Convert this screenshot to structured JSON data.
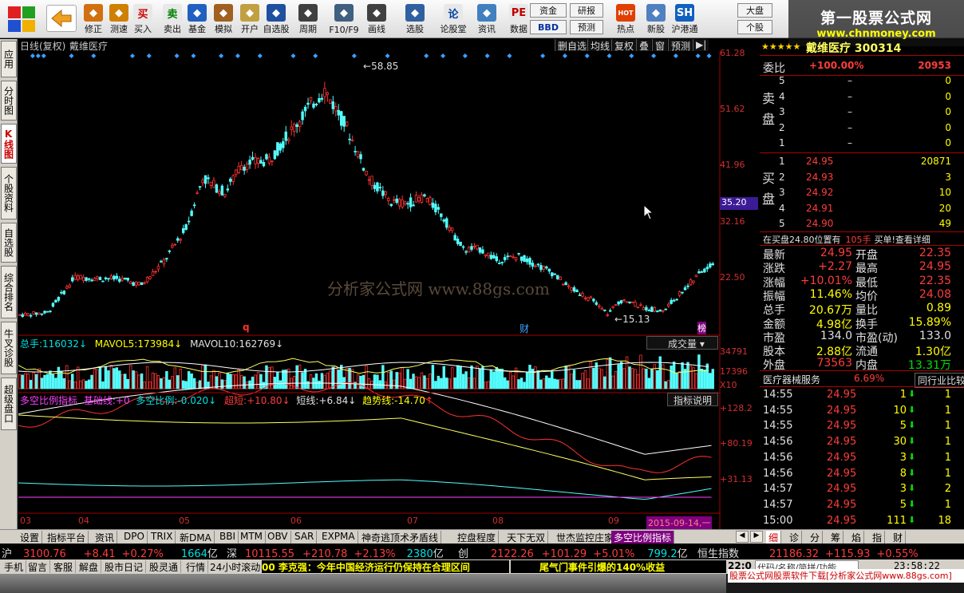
{
  "toolbar": {
    "buttons": [
      {
        "label": "修正",
        "icon": "up-down-icon",
        "color": "#d07010"
      },
      {
        "label": "测速",
        "icon": "clock-icon",
        "color": "#d08000"
      },
      {
        "label": "买入",
        "icon": "buy-icon",
        "glyph": "买",
        "color": "#e8e8e8",
        "glyph_color": "#d00000"
      },
      {
        "label": "卖出",
        "icon": "sell-icon",
        "glyph": "卖",
        "color": "#e8e8e8",
        "glyph_color": "#008000"
      },
      {
        "label": "基金",
        "icon": "fund-icon",
        "color": "#2060c0"
      },
      {
        "label": "模拟",
        "icon": "hammer-icon",
        "color": "#a06020"
      },
      {
        "label": "开户",
        "icon": "lock-icon",
        "color": "#c0a040"
      },
      {
        "label": "自选股",
        "icon": "star-icon",
        "color": "#2050a0"
      },
      {
        "label": "周期",
        "icon": "clock-icon",
        "color": "#404040"
      },
      {
        "label": "F10/F9",
        "icon": "document-icon",
        "color": "#406080"
      },
      {
        "label": "画线",
        "icon": "pen-icon",
        "color": "#404040"
      },
      {
        "label": "选股",
        "icon": "grid-icon",
        "color": "#3060a0"
      },
      {
        "label": "论股堂",
        "icon": "forum-icon",
        "glyph": "论",
        "color": "#e8e8e8",
        "glyph_color": "#0040a0"
      },
      {
        "label": "资讯",
        "icon": "news-icon",
        "color": "#4080c0"
      },
      {
        "label": "数据",
        "icon": "pe-icon",
        "glyph": "PE",
        "color": "#e8e8e8",
        "glyph_color": "#c00000"
      },
      {
        "label": "热点",
        "icon": "hot-icon",
        "glyph": "HOT",
        "color": "#e04000"
      },
      {
        "label": "新股",
        "icon": "new-stock-icon",
        "color": "#5080c0"
      },
      {
        "label": "沪港通",
        "icon": "hk-link-icon",
        "glyph": "SH",
        "color": "#1060c0"
      }
    ],
    "chips": {
      "fund": "资金",
      "bbd": "BBD",
      "research": "研报",
      "forecast": "预测",
      "market": "大盘",
      "single": "个股"
    }
  },
  "logo_banner": {
    "line1": "第一股票公式网",
    "line2": "www.chnmoney.com"
  },
  "left_tabs": [
    "应用",
    "分时图",
    "K线图",
    "个股资料",
    "自选股",
    "综合排名",
    "牛叉诊股",
    "超级盘口"
  ],
  "chart": {
    "header": {
      "period": "日线(复权)",
      "name": "戴维医疗"
    },
    "header_buttons": [
      "删自选",
      "均线",
      "复权",
      "叠",
      "窗",
      "预测",
      "▶|"
    ],
    "y_axis": [
      "61.28",
      "51.62",
      "41.96",
      "35.20",
      "32.16",
      "22.50"
    ],
    "cursor_price": "35.20",
    "high_label": "58.85",
    "low_label": "15.13",
    "markers": {
      "q": "q",
      "cai": "财",
      "bang": "榜"
    },
    "watermark": "分析家公式网  www.88gs.com"
  },
  "volume": {
    "total_label": "总手:",
    "total": "116032",
    "mavol5_label": "MAVOL5:",
    "mavol5": "173984",
    "mavol10_label": "MAVOL10:",
    "mavol10": "162769",
    "selector": "成交量",
    "axis": [
      "34791",
      "17396",
      "X10"
    ]
  },
  "indicator": {
    "name": "多空比例指标",
    "base_label": "基础线:",
    "base": "+0",
    "ratio_label": "多空比例:",
    "ratio": "-0.020",
    "ultrashort_label": "超短:",
    "ultrashort": "+10.80",
    "short_label": "短线:",
    "short": "+6.84",
    "trend_label": "趋势线:",
    "trend": "-14.70",
    "help": "指标说明",
    "axis": [
      "+128.2",
      "+80.19",
      "+31.13"
    ]
  },
  "x_axis": [
    "03",
    "04",
    "05",
    "06",
    "07",
    "08",
    "09",
    "2015-09-14,一"
  ],
  "right_panel": {
    "title": "戴维医疗 300314",
    "weibi_label": "委比",
    "weibi": "+100.00%",
    "weibi_val": "20953",
    "sell_label": "卖盘",
    "buy_label": "买盘",
    "sell": [
      {
        "n": "5",
        "p": "–",
        "v": "0"
      },
      {
        "n": "4",
        "p": "–",
        "v": "0"
      },
      {
        "n": "3",
        "p": "–",
        "v": "0"
      },
      {
        "n": "2",
        "p": "–",
        "v": "0"
      },
      {
        "n": "1",
        "p": "–",
        "v": "0"
      }
    ],
    "buy": [
      {
        "n": "1",
        "p": "24.95",
        "v": "20871"
      },
      {
        "n": "2",
        "p": "24.93",
        "v": "3"
      },
      {
        "n": "3",
        "p": "24.92",
        "v": "10"
      },
      {
        "n": "4",
        "p": "24.91",
        "v": "20"
      },
      {
        "n": "5",
        "p": "24.90",
        "v": "49"
      }
    ],
    "buy_notice": {
      "prefix": "在买盘24.80位置有",
      "amount": "105手",
      "suffix": "买单!",
      "link": "查看详细"
    },
    "stats": [
      {
        "l1": "最新",
        "v1": "24.95",
        "c1": "red",
        "l2": "开盘",
        "v2": "22.35",
        "c2": "red"
      },
      {
        "l1": "涨跌",
        "v1": "+2.27",
        "c1": "red",
        "l2": "最高",
        "v2": "24.95",
        "c2": "red"
      },
      {
        "l1": "涨幅",
        "v1": "+10.01%",
        "c1": "red",
        "l2": "最低",
        "v2": "22.35",
        "c2": "red"
      },
      {
        "l1": "振幅",
        "v1": "11.46%",
        "c1": "yel",
        "l2": "均价",
        "v2": "24.08",
        "c2": "red"
      },
      {
        "l1": "总手",
        "v1": "20.67万",
        "c1": "yel",
        "l2": "量比",
        "v2": "0.89",
        "c2": "yel"
      },
      {
        "l1": "金额",
        "v1": "4.98亿",
        "c1": "yel",
        "l2": "换手",
        "v2": "15.89%",
        "c2": "yel"
      },
      {
        "l1": "市盈",
        "v1": "134.0",
        "c1": "wh",
        "l2": "市盈(动)",
        "v2": "133.0",
        "c2": "wh"
      },
      {
        "l1": "股本",
        "v1": "2.88亿",
        "c1": "yel",
        "l2": "流通",
        "v2": "1.30亿",
        "c2": "yel"
      },
      {
        "l1": "外盘",
        "v1": "73563",
        "c1": "red",
        "l2": "内盘",
        "v2": "13.31万",
        "c2": "grn"
      }
    ],
    "industry": {
      "name": "医疗器械服务",
      "pct": "6.69%",
      "btn": "同行业比较"
    },
    "ticks": [
      {
        "t": "14:55",
        "p": "24.95",
        "v": "1",
        "d": "1"
      },
      {
        "t": "14:55",
        "p": "24.95",
        "v": "10",
        "d": "1"
      },
      {
        "t": "14:55",
        "p": "24.95",
        "v": "5",
        "d": "1"
      },
      {
        "t": "14:56",
        "p": "24.95",
        "v": "30",
        "d": "1"
      },
      {
        "t": "14:56",
        "p": "24.95",
        "v": "3",
        "d": "1"
      },
      {
        "t": "14:56",
        "p": "24.95",
        "v": "8",
        "d": "1"
      },
      {
        "t": "14:57",
        "p": "24.95",
        "v": "3",
        "d": "2"
      },
      {
        "t": "14:57",
        "p": "24.95",
        "v": "5",
        "d": "1"
      },
      {
        "t": "15:00",
        "p": "24.95",
        "v": "111",
        "d": "18"
      }
    ]
  },
  "bottom_tabs": [
    "设置",
    "指标平台",
    "资讯",
    "DPO",
    "TRIX",
    "新DMA",
    "BBI",
    "MTM",
    "OBV",
    "SAR",
    "EXPMA",
    "神奇逃顶术矛盾线",
    "控盘程度",
    "天下无双",
    "世杰监控庄家",
    "多空比例指标"
  ],
  "right_bottom_tabs": [
    "细",
    "诊",
    "分",
    "筹",
    "焰",
    "指",
    "财"
  ],
  "quote_bar": {
    "sh_label": "沪",
    "sh": "3100.76",
    "sh_chg": "+8.41",
    "sh_pct": "+0.27%",
    "sh_amt": "1664",
    "sh_unit": "亿",
    "sz_label": "深",
    "sz": "10115.55",
    "sz_chg": "+210.78",
    "sz_pct": "+2.13%",
    "sz_amt": "2380",
    "sz_unit": "亿",
    "cy_label": "创",
    "cy": "2122.26",
    "cy_chg": "+101.29",
    "cy_pct": "+5.01%",
    "cy_amt": "799.2",
    "cy_unit": "亿",
    "hs_label": "恒生指数",
    "hs": "21186.32",
    "hs_chg": "+115.93",
    "hs_pct": "+0.55%"
  },
  "status_bar": {
    "items": [
      "手机",
      "留言",
      "客服",
      "解盘",
      "股市日记",
      "股灵通",
      "行情",
      "24小时滚动"
    ],
    "news1": "00 李克强：今年中国经济运行仍保持在合理区间",
    "news2": "尾气门事件引爆的140%收益",
    "search_hint": "代码/名称/简拼/功能",
    "time": "23:58:22",
    "clock_prefix": "22:0"
  },
  "footer": {
    "text": "股票公式网股票软件下载[分析家公式网www.88gs.com]"
  }
}
